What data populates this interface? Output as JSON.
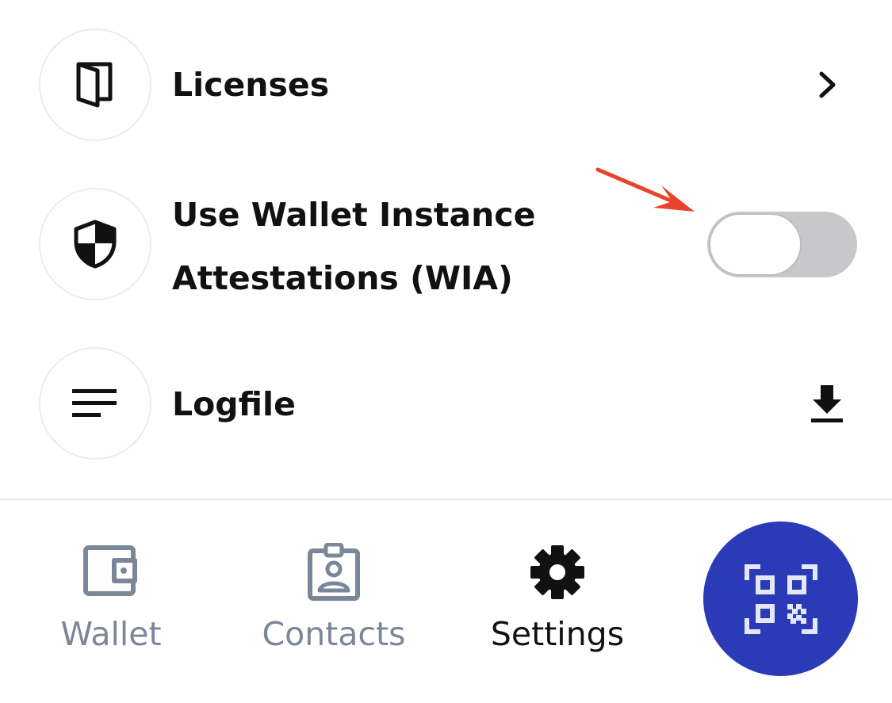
{
  "settings_list": {
    "items": [
      {
        "label": "Licenses",
        "icon": "book-icon",
        "trailing": "chevron-right-icon"
      },
      {
        "label": "Use Wallet Instance Attestations (WIA)",
        "icon": "shield-icon",
        "trailing": "toggle",
        "toggle_on": false
      },
      {
        "label": "Logfile",
        "icon": "lines-icon",
        "trailing": "download-icon"
      }
    ]
  },
  "annotation": {
    "color": "#e8432d"
  },
  "tabbar": {
    "tabs": [
      {
        "label": "Wallet",
        "icon": "wallet-icon",
        "active": false
      },
      {
        "label": "Contacts",
        "icon": "contact-badge-icon",
        "active": false
      },
      {
        "label": "Settings",
        "icon": "gear-icon",
        "active": true
      }
    ],
    "scan_button": {
      "icon": "qr-code-icon",
      "color": "#2b3bb8"
    },
    "inactive_color": "#7a8799",
    "active_color": "#111111"
  }
}
